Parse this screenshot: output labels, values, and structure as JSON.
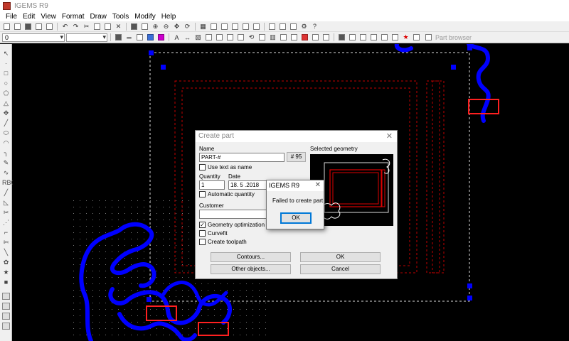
{
  "window": {
    "title": "IGEMS R9"
  },
  "menu": [
    "File",
    "Edit",
    "View",
    "Format",
    "Draw",
    "Tools",
    "Modify",
    "Help"
  ],
  "toolbar2": {
    "layer_value": "0",
    "part_browser_label": "Part browser"
  },
  "create_part": {
    "title": "Create part",
    "name_label": "Name",
    "name_value": "PART-#",
    "number_button": "# 95",
    "use_text_as_name": "Use text as name",
    "quantity_label": "Quantity",
    "quantity_value": "1",
    "date_label": "Date",
    "date_value": "18. 5 .2018",
    "automatic_quantity": "Automatic quantity",
    "customer_label": "Customer",
    "customer_value": "",
    "geometry_optimization": "Geometry optimization 0.90",
    "geometry_optimization_checked": true,
    "curvefit": "Curvefit",
    "create_toolpath": "Create toolpath",
    "contours_button": "Contours...",
    "other_objects_button": "Other objects...",
    "ok_button": "OK",
    "cancel_button": "Cancel",
    "selected_geometry_label": "Selected geometry"
  },
  "message_box": {
    "title": "IGEMS R9",
    "text": "Failed to create part",
    "ok_button": "OK"
  },
  "colors": {
    "canvas": "#000000",
    "geometry_blue": "#0000ff",
    "dashed_red": "#c00000",
    "highlight_red": "#ff2020",
    "dialog_bg": "#f0f0f0"
  }
}
